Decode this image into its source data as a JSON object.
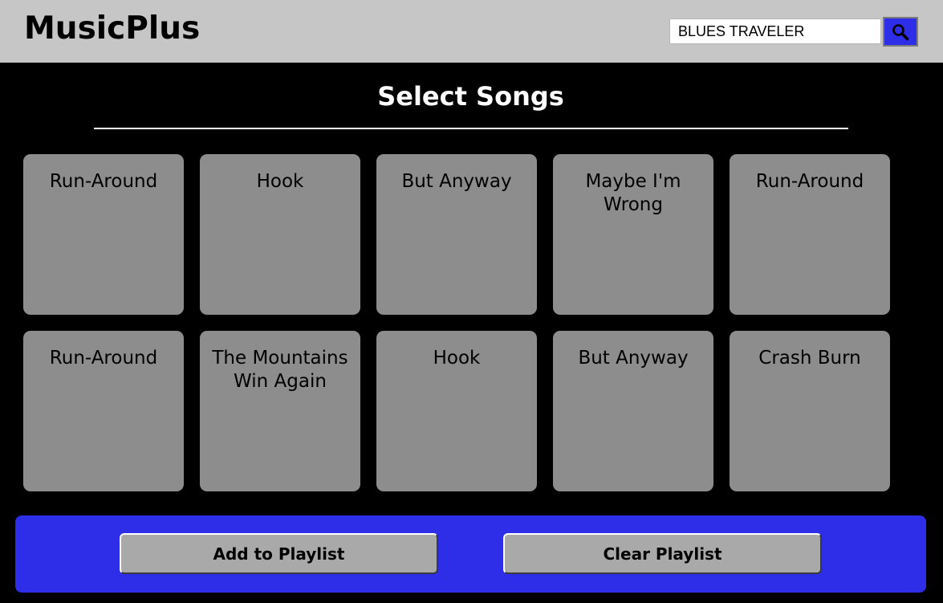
{
  "app": {
    "title": "MusicPlus"
  },
  "search": {
    "value": "BLUES TRAVELER",
    "button_icon": "search-icon"
  },
  "main": {
    "title": "Select Songs"
  },
  "songs": [
    {
      "label": "Run-Around"
    },
    {
      "label": "Hook"
    },
    {
      "label": "But Anyway"
    },
    {
      "label": "Maybe I'm Wrong"
    },
    {
      "label": "Run-Around"
    },
    {
      "label": "Run-Around"
    },
    {
      "label": "The Mountains Win Again"
    },
    {
      "label": "Hook"
    },
    {
      "label": "But Anyway"
    },
    {
      "label": "Crash Burn"
    }
  ],
  "footer": {
    "add_label": "Add to Playlist",
    "clear_label": "Clear Playlist"
  },
  "colors": {
    "background": "#000000",
    "header": "#c6c6c6",
    "accent": "#2e2ee8",
    "card": "#8d8d8d",
    "button": "#a9a9a9"
  }
}
